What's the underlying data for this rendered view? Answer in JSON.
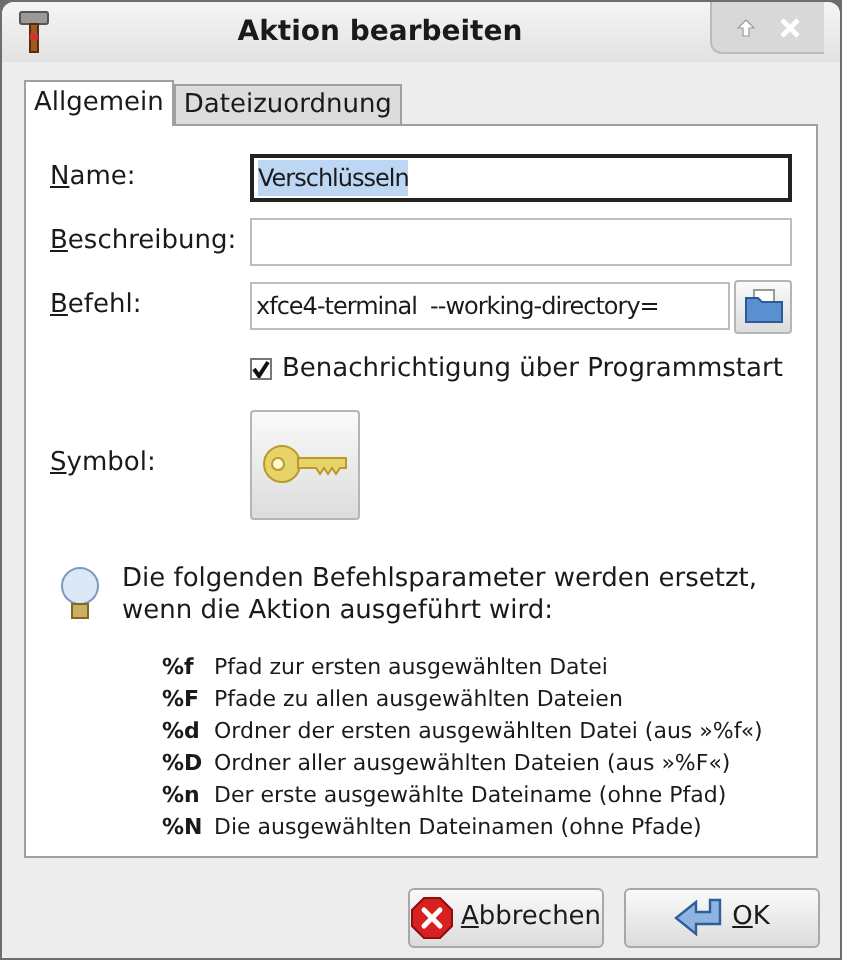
{
  "window": {
    "title": "Aktion bearbeiten"
  },
  "tabs": [
    {
      "label": "Allgemein",
      "selected": true
    },
    {
      "label": "Dateizuordnung",
      "selected": false
    }
  ],
  "fields": [
    {
      "label": "Name:",
      "value": "Verschlüsseln",
      "focused": true
    },
    {
      "label": "Beschreibung:",
      "focused": false
    },
    {
      "label": "Befehl:",
      "value": "xfce4-terminal  --working-directory=",
      "focused": false
    }
  ],
  "notify": {
    "label": "Benachrichtigung über Programmstart",
    "checked": true
  },
  "symbol": {
    "label": "Symbol:"
  },
  "info": {
    "line1": "Die folgenden Befehlsparameter werden ersetzt,",
    "line2": "wenn die Aktion ausgeführt wird:"
  },
  "params": [
    {
      "code": "%f",
      "text": "Pfad zur ersten ausgewählten Datei"
    },
    {
      "code": "%F",
      "text": "Pfade zu allen ausgewählten Dateien"
    },
    {
      "code": "%d",
      "text": "Ordner der ersten ausgewählten Datei (aus »%f«)"
    },
    {
      "code": "%D",
      "text": "Ordner aller ausgewählten Dateien (aus »%F«)"
    },
    {
      "code": "%n",
      "text": "Der erste ausgewählte Dateiname (ohne Pfad)"
    },
    {
      "code": "%N",
      "text": "Die ausgewählten Dateinamen (ohne Pfade)"
    }
  ],
  "buttons": [
    {
      "kind": "cancel",
      "label": "Abbrechen"
    },
    {
      "kind": "ok",
      "label": "OK"
    }
  ]
}
